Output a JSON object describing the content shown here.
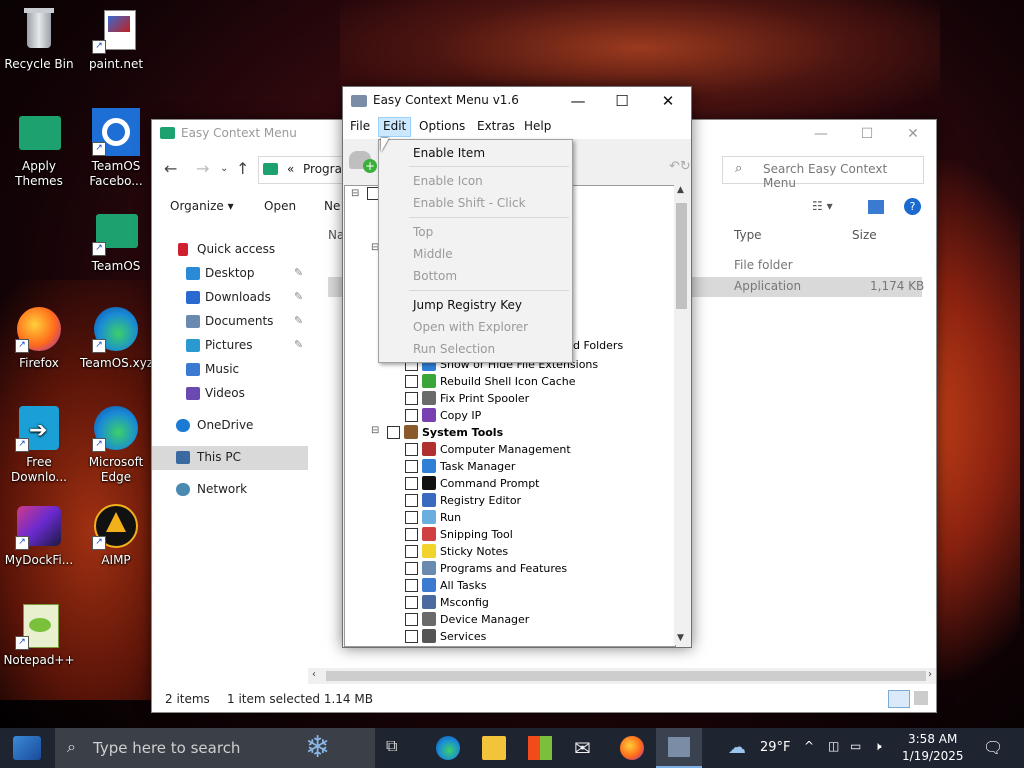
{
  "desktop": {
    "icons": [
      {
        "label": "Recycle Bin"
      },
      {
        "label": "paint.net"
      },
      {
        "label": "Apply Themes"
      },
      {
        "label": "TeamOS Facebo..."
      },
      {
        "label": "TeamOS"
      },
      {
        "label": "Firefox"
      },
      {
        "label": "TeamOS.xyz"
      },
      {
        "label": "Free Downlo..."
      },
      {
        "label": "Microsoft Edge"
      },
      {
        "label": "MyDockFi..."
      },
      {
        "label": "AIMP"
      },
      {
        "label": "Notepad++"
      }
    ]
  },
  "explorer": {
    "title": "Easy Context Menu",
    "address_prefix": "«",
    "address_text": "Progra",
    "search_placeholder": "Search Easy Context Menu",
    "commands": {
      "organize": "Organize ▾",
      "open": "Open",
      "new_folder": "Ne"
    },
    "nav": [
      {
        "label": "Quick access"
      },
      {
        "label": "Desktop"
      },
      {
        "label": "Downloads"
      },
      {
        "label": "Documents"
      },
      {
        "label": "Pictures"
      },
      {
        "label": "Music"
      },
      {
        "label": "Videos"
      },
      {
        "label": "OneDrive"
      },
      {
        "label": "This PC"
      },
      {
        "label": "Network"
      }
    ],
    "columns": {
      "name": "Na",
      "type": "Type",
      "size": "Size"
    },
    "rows": [
      {
        "type": "File folder",
        "size": ""
      },
      {
        "type": "Application",
        "size": "1,174 KB"
      }
    ],
    "status": {
      "items": "2 items",
      "selected": "1 item selected  1.14 MB"
    }
  },
  "ecm": {
    "title": "Easy Context Menu v1.6",
    "menu": [
      "File",
      "Edit",
      "Options",
      "Extras",
      "Help"
    ],
    "edit_menu": [
      {
        "label": "Enable Item",
        "enabled": true
      },
      {
        "label": "Enable Icon",
        "enabled": false
      },
      {
        "label": "Enable Shift - Click",
        "enabled": false
      },
      {
        "label": "Top",
        "enabled": false
      },
      {
        "label": "Middle",
        "enabled": false
      },
      {
        "label": "Bottom",
        "enabled": false
      },
      {
        "label": "Jump Registry Key",
        "enabled": true
      },
      {
        "label": "Open with Explorer",
        "enabled": false
      },
      {
        "label": "Run Selection",
        "enabled": false
      }
    ],
    "tree_partial": "nd Folders",
    "tree": [
      {
        "label": "Show or Hide File Extensions",
        "color": "#2f7fd6"
      },
      {
        "label": "Rebuild Shell Icon Cache",
        "color": "#3aa63a"
      },
      {
        "label": "Fix Print Spooler",
        "color": "#6a6a6a"
      },
      {
        "label": "Copy IP",
        "color": "#7a3fb0"
      },
      {
        "label": "System Tools",
        "color": "#8a5a2a",
        "group": true
      },
      {
        "label": "Computer Management",
        "color": "#b03030"
      },
      {
        "label": "Task Manager",
        "color": "#2f7fd6"
      },
      {
        "label": "Command Prompt",
        "color": "#111111"
      },
      {
        "label": "Registry Editor",
        "color": "#3a6ac0"
      },
      {
        "label": "Run",
        "color": "#6aaee0"
      },
      {
        "label": "Snipping Tool",
        "color": "#d04040"
      },
      {
        "label": "Sticky Notes",
        "color": "#f2d32b"
      },
      {
        "label": "Programs and Features",
        "color": "#6a8ab0"
      },
      {
        "label": "All Tasks",
        "color": "#3a7ad0"
      },
      {
        "label": "Msconfig",
        "color": "#4a6aa0"
      },
      {
        "label": "Device Manager",
        "color": "#6a6a6a"
      },
      {
        "label": "Services",
        "color": "#555555"
      }
    ]
  },
  "taskbar": {
    "search_placeholder": "Type here to search",
    "temperature": "29°F",
    "time": "3:58 AM",
    "date": "1/19/2025"
  }
}
